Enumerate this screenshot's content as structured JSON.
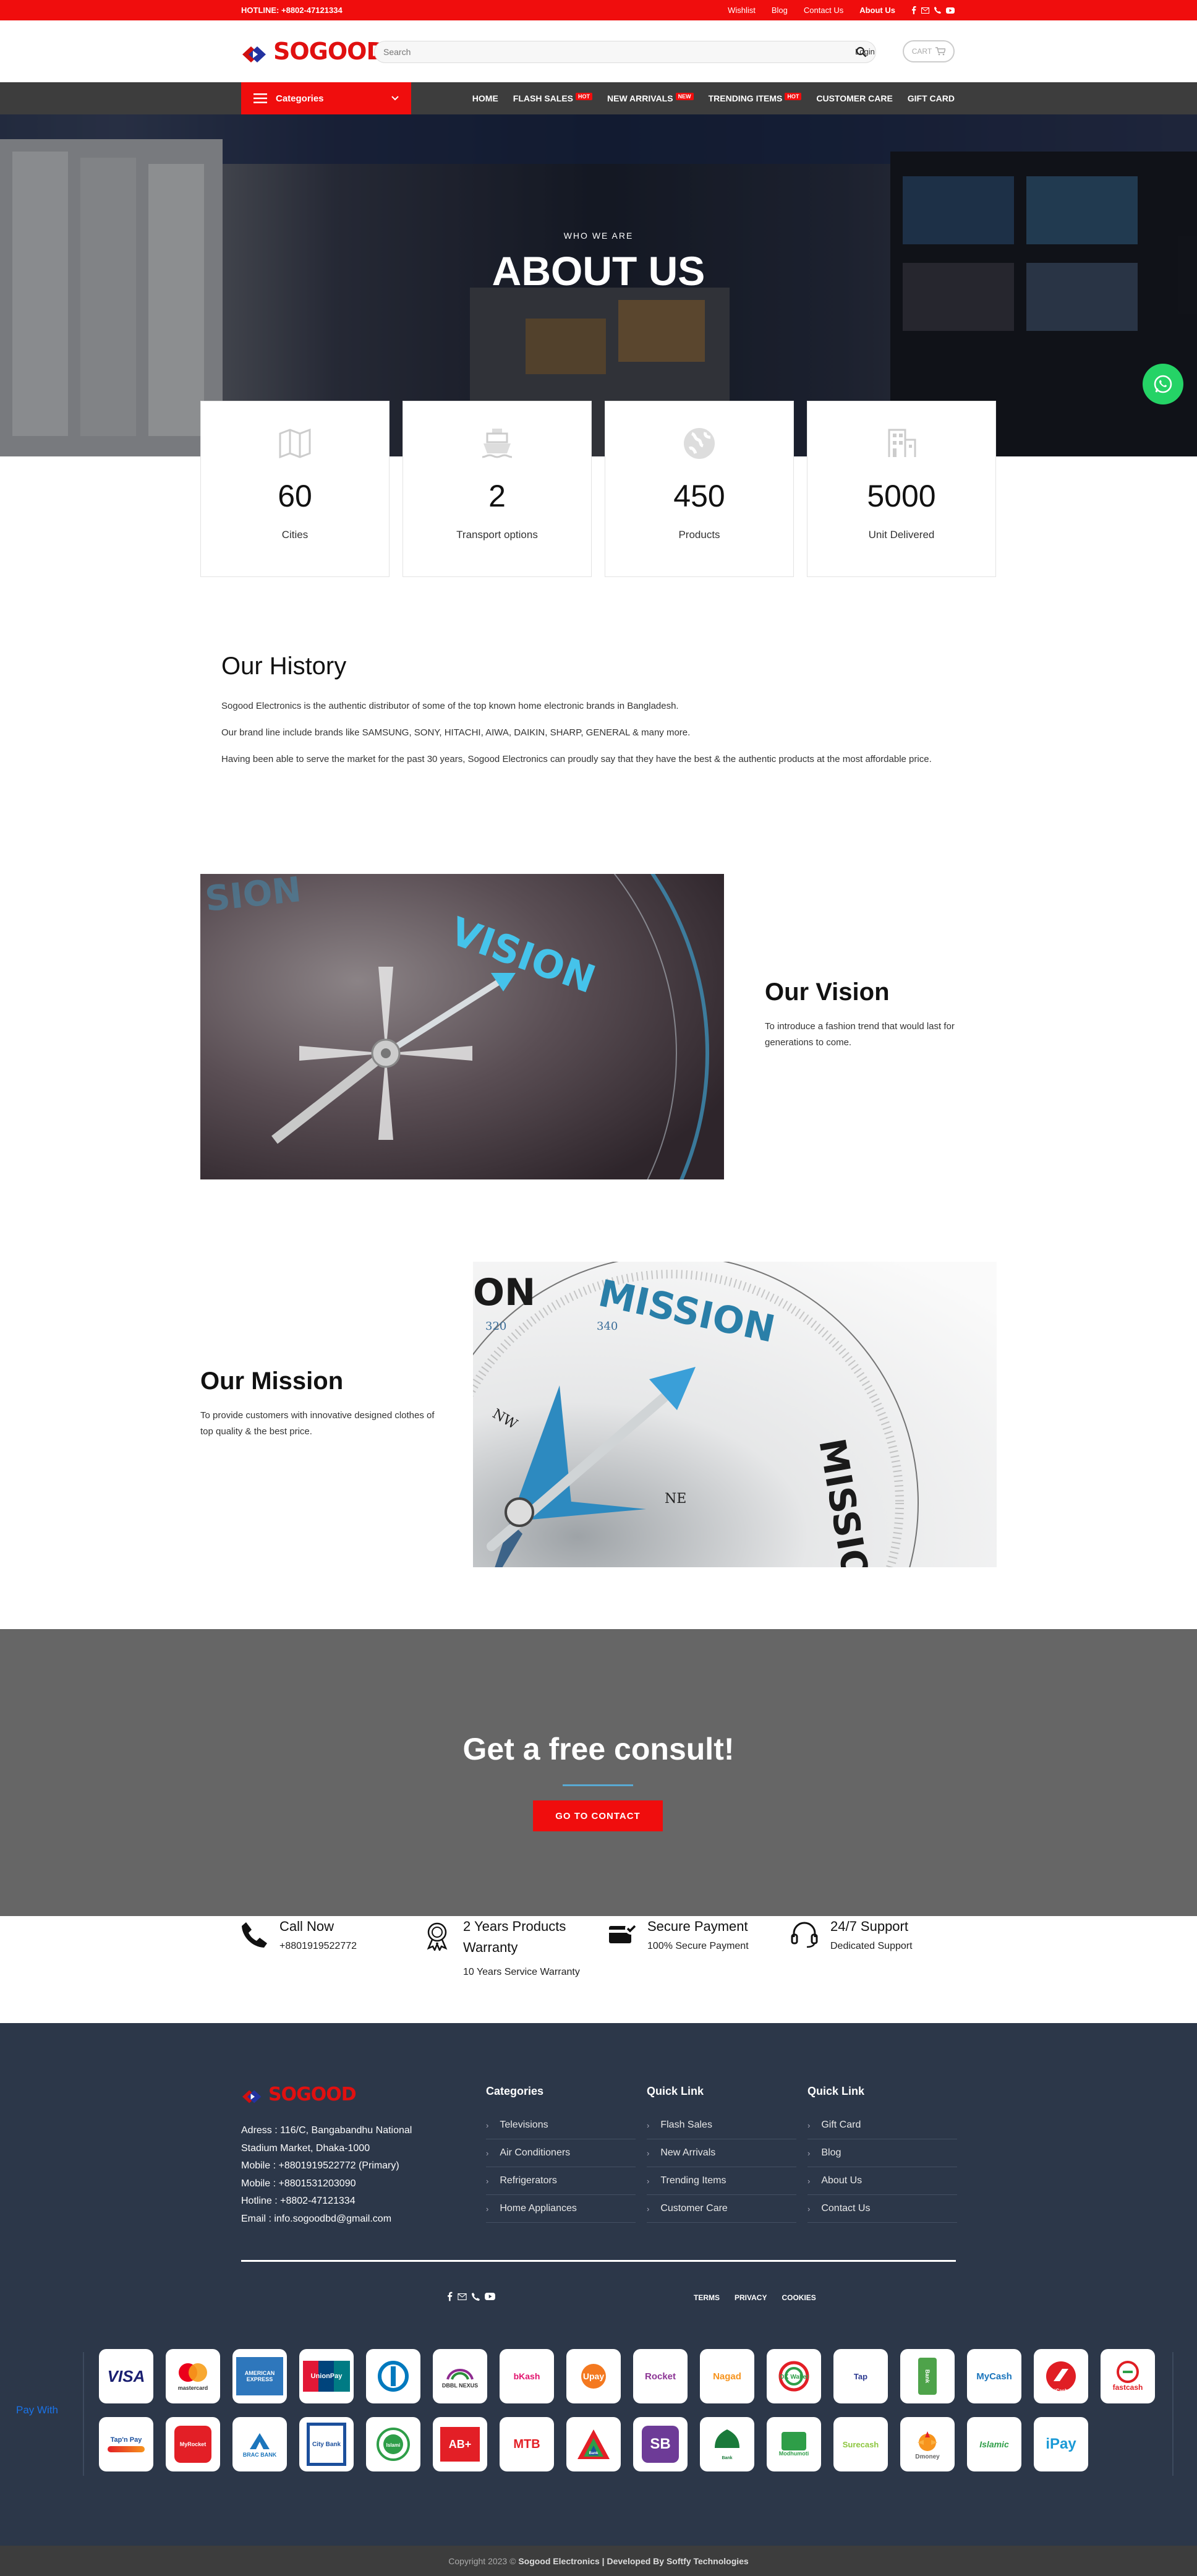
{
  "topbar": {
    "hotline": "HOTLINE: +8802-47121334",
    "links": [
      "Wishlist",
      "Blog",
      "Contact Us",
      "About Us"
    ]
  },
  "header": {
    "logo": "SOGOOD",
    "search_placeholder": "Search",
    "login": "Login",
    "cart": "CART"
  },
  "nav": {
    "categories": "Categories",
    "items": [
      {
        "label": "HOME"
      },
      {
        "label": "FLASH SALES",
        "badge": "HOT"
      },
      {
        "label": "NEW ARRIVALS",
        "badge": "NEW"
      },
      {
        "label": "TRENDING ITEMS",
        "badge": "HOT"
      },
      {
        "label": "CUSTOMER CARE"
      },
      {
        "label": "GIFT CARD"
      }
    ]
  },
  "hero": {
    "kicker": "WHO WE ARE",
    "title": "ABOUT US"
  },
  "stats": [
    {
      "value": "60",
      "label": "Cities",
      "icon": "map-icon"
    },
    {
      "value": "2",
      "label": "Transport options",
      "icon": "ship-icon"
    },
    {
      "value": "450",
      "label": "Products",
      "icon": "globe-icon"
    },
    {
      "value": "5000",
      "label": "Unit Delivered",
      "icon": "building-icon"
    }
  ],
  "history": {
    "title": "Our History",
    "paragraphs": [
      "Sogood Electronics is the authentic distributor of some of the top known home electronic brands in Bangladesh.",
      "Our brand line include brands like SAMSUNG, SONY, HITACHI, AIWA, DAIKIN, SHARP, GENERAL & many more.",
      "Having been able to serve the market for the past 30 years, Sogood Electronics can proudly say that they have the best & the authentic products at the most affordable price."
    ]
  },
  "vision": {
    "title": "Our Vision",
    "text": "To introduce a fashion trend that would last for generations to come.",
    "image_word": "VISION",
    "image_word_faded": "SION"
  },
  "mission": {
    "title": "Our Mission",
    "text": "To provide customers with innovative designed clothes of top quality & the best price.",
    "image_word": "MISSION",
    "image_word_side": "MISSIO",
    "image_word_faded": "ON",
    "image_marks": [
      "320",
      "340",
      "NW",
      "NE"
    ]
  },
  "consult": {
    "title": "Get a free consult!",
    "button": "GO TO CONTACT"
  },
  "features": [
    {
      "title": "Call Now",
      "sub": "+8801919522772",
      "icon": "phone-icon"
    },
    {
      "title": "2 Years Products Warranty",
      "sub": "10 Years Service Warranty",
      "icon": "award-icon"
    },
    {
      "title": "Secure Payment",
      "sub": "100% Secure Payment",
      "icon": "secure-payment-icon"
    },
    {
      "title": "24/7 Support",
      "sub": "Dedicated Support",
      "icon": "headset-icon"
    }
  ],
  "footer": {
    "logo": "SOGOOD",
    "address_lines": [
      "Adress : 116/C, Bangabandhu National",
      "Stadium Market, Dhaka-1000",
      "Mobile : +8801919522772 (Primary)",
      "Mobile : +8801531203090",
      "Hotline : +8802-47121334",
      "Email : info.sogoodbd@gmail.com"
    ],
    "categories": {
      "title": "Categories",
      "items": [
        "Televisions",
        "Air Conditioners",
        "Refrigerators",
        "Home Appliances"
      ]
    },
    "quick1": {
      "title": "Quick Link",
      "items": [
        "Flash Sales",
        "New Arrivals",
        "Trending Items",
        "Customer Care"
      ]
    },
    "quick2": {
      "title": "Quick Link",
      "items": [
        "Gift Card",
        "Blog",
        "About Us",
        "Contact Us"
      ]
    },
    "legal": [
      "TERMS",
      "PRIVACY",
      "COOKIES"
    ],
    "pay_with": "Pay With",
    "payments_row1": [
      "VISA",
      "mastercard",
      "AMERICAN EXPRESS",
      "UnionPay",
      "Diners",
      "DBBL NEXUS",
      "bKash",
      "Upay",
      "Rocket",
      "Nagad",
      "OK Wallet",
      "Tap",
      "Bank",
      "MyCash",
      "fastcash",
      "iCash"
    ],
    "payments_row2": [
      "Tap'n Pay",
      "MyRocket",
      "BRAC BANK",
      "City Bank",
      "Islami",
      "AB+",
      "MTB",
      "Bank",
      "SB",
      "Bank",
      "Modhumoti",
      "Surecash",
      "Dmoney",
      "Islamic",
      "iPay"
    ]
  },
  "copyright": {
    "prefix": "Copyright 2023 ©",
    "company": "Sogood Electronics",
    "sep": "|",
    "dev": "Developed By Softfy Technologies"
  }
}
